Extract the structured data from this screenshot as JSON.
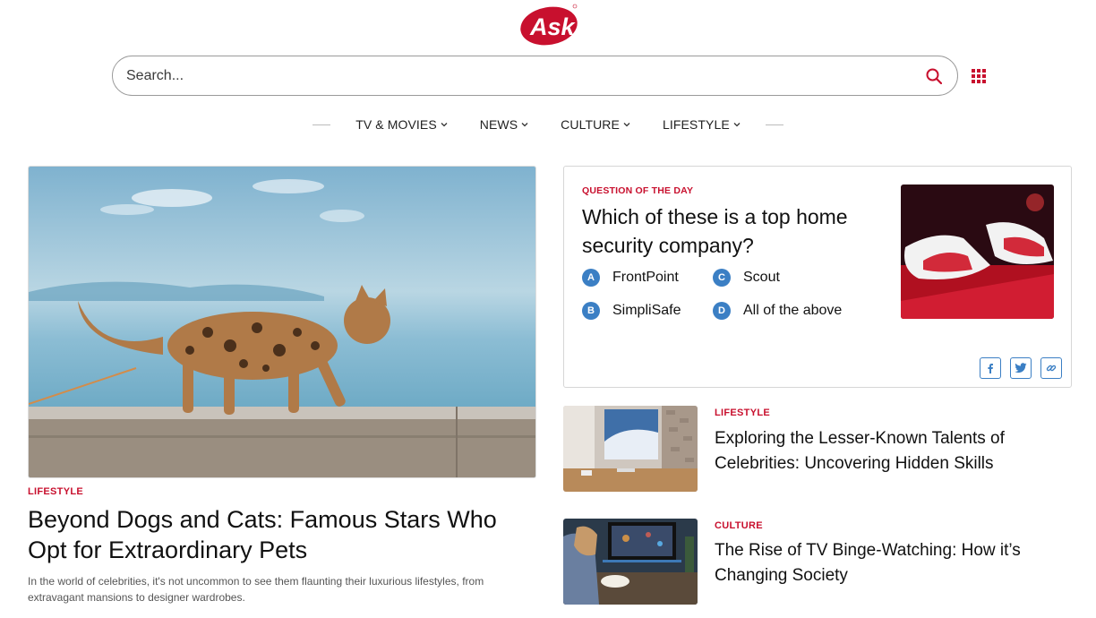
{
  "header": {
    "logo_text": "Ask",
    "brand_color": "#c8102e",
    "search": {
      "placeholder": "Search...",
      "value": ""
    }
  },
  "nav": {
    "items": [
      {
        "label": "TV & MOVIES"
      },
      {
        "label": "NEWS"
      },
      {
        "label": "CULTURE"
      },
      {
        "label": "LIFESTYLE"
      }
    ]
  },
  "hero": {
    "category": "LIFESTYLE",
    "title": "Beyond Dogs and Cats: Famous Stars Who Opt for Extraordinary Pets",
    "description": "In the world of celebrities, it's not uncommon to see them flaunting their luxurious lifestyles, from extravagant mansions to designer wardrobes.",
    "image": "bengal-cat-walking-on-wooden-rail"
  },
  "question": {
    "label": "QUESTION OF THE DAY",
    "text": "Which of these is a top home security company?",
    "options": [
      {
        "letter": "A",
        "text": "FrontPoint"
      },
      {
        "letter": "C",
        "text": "Scout"
      },
      {
        "letter": "B",
        "text": "SimpliSafe"
      },
      {
        "letter": "D",
        "text": "All of the above"
      }
    ],
    "image": "red-white-sneakers",
    "accent_color": "#3b7fc4",
    "share": [
      "facebook-icon",
      "twitter-icon",
      "link-icon"
    ]
  },
  "articles": [
    {
      "category": "LIFESTYLE",
      "title": "Exploring the Lesser-Known Talents of Celebrities: Uncovering Hidden Skills",
      "image": "loft-room-with-painting"
    },
    {
      "category": "CULTURE",
      "title": "The Rise of TV Binge-Watching: How it’s Changing Society",
      "image": "person-watching-tv-with-popcorn"
    }
  ]
}
